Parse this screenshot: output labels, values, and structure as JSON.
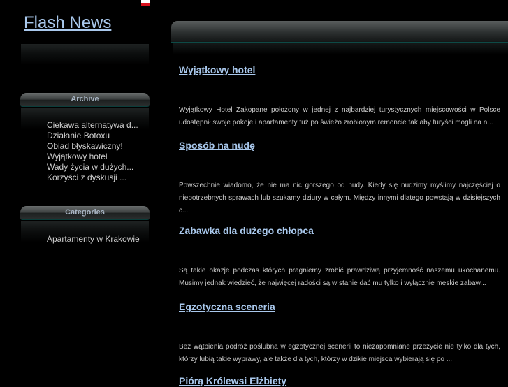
{
  "header": {
    "site_title": "Flash News",
    "language_flag": {
      "icon": "poland-flag-icon",
      "colors": [
        "#ffffff",
        "#d8101c"
      ]
    }
  },
  "sidebar": {
    "archive": {
      "heading": "Archive",
      "items": [
        "Ciekawa alternatywa d...",
        "Działanie Botoxu",
        "Obiad błyskawiczny!",
        "Wyjątkowy hotel",
        "Wady życia w dużych...",
        "Korzyści z dyskusji ..."
      ]
    },
    "categories": {
      "heading": "Categories",
      "items": [
        "Apartamenty w Krakowie"
      ]
    }
  },
  "posts": [
    {
      "title": "Wyjątkowy hotel",
      "excerpt": "Wyjątkowy Hotel Zakopane położony w jednej z najbardziej turystycznych miejscowości w Polsce udostępnił swoje pokoje i apartamenty tuż po świeżo zrobionym remoncie tak aby turyści mogli na n..."
    },
    {
      "title": "Sposób na nudę",
      "excerpt": "Powszechnie wiadomo, że nie ma nic gorszego od nudy. Kiedy się nudzimy myślimy najczęściej o niepotrzebnych sprawach lub szukamy dziury w całym. Między innymi dlatego powstają w dzisiejszych c..."
    },
    {
      "title": "Zabawka dla dużego chłopca",
      "excerpt": "Są takie okazje podczas których pragniemy zrobić prawdziwą przyjemność naszemu ukochanemu. Musimy jednak wiedzieć, że najwięcej radości są w stanie dać mu tylko i wyłącznie męskie zabaw..."
    },
    {
      "title": "Egzotyczna sceneria",
      "excerpt": "Bez wątpienia podróż poślubna w egzotycznej scenerii to niezapomniane przeżycie nie tylko dla tych, którzy lubią takie wyprawy, ale także dla tych, którzy w dzikie miejsca wybierają się po ..."
    },
    {
      "title": "Piórą Królewsi Elżbiety"
    }
  ],
  "colors": {
    "link": "#a9c8ec",
    "background": "#000000",
    "accent_teal": "#0d4a46"
  }
}
